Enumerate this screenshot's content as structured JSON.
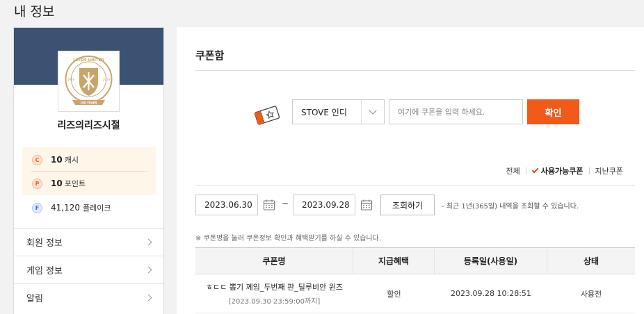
{
  "page": {
    "title": "내 정보"
  },
  "profile": {
    "badge_text": "LEEDS UNITED",
    "badge_year_left": "1919",
    "badge_year_right": "2019",
    "badge_banner": "100 YEARS",
    "nickname": "리즈의리즈시절",
    "wallet": {
      "cash": {
        "symbol": "C",
        "amount": "10",
        "unit": "캐시"
      },
      "point": {
        "symbol": "P",
        "amount": "10",
        "unit": "포인트"
      }
    },
    "flake": {
      "symbol": "F",
      "amount": "41,120",
      "unit": "플레이크"
    },
    "menu": [
      {
        "label": "회원 정보"
      },
      {
        "label": "게임 정보"
      },
      {
        "label": "알림"
      }
    ]
  },
  "coupon": {
    "title": "쿠폰함",
    "select_value": "STOVE 인디",
    "input_placeholder": "여기에 쿠폰을 입력 하세요.",
    "confirm_label": "확인",
    "filters": [
      {
        "label": "전체",
        "active": false
      },
      {
        "label": "사용가능쿠폰",
        "active": true
      },
      {
        "label": "지난쿠폰",
        "active": false
      }
    ],
    "date_start": "2023.06.30",
    "date_separator": "~",
    "date_end": "2023.09.28",
    "query_label": "조회하기",
    "query_note": "- 최근 1년(365일) 내역을 조회할 수 있습니다.",
    "hint": "※ 쿠폰명을 눌러 쿠폰정보 확인과 혜택받기를 하실 수 있습니다.",
    "table": {
      "headers": [
        "쿠폰명",
        "지급혜택",
        "등록일(사용일)",
        "상태"
      ],
      "rows": [
        {
          "name": "ㅎㄷㄷ 뽑기 께임_두번째 판_딜루비안 윈즈",
          "expiry": "[2023.09.30 23:59:00까지]",
          "benefit": "할인",
          "registered": "2023.09.28 10:28:51",
          "status": "사용전"
        }
      ]
    }
  },
  "colors": {
    "accent": "#f15a18",
    "banner": "#3b5272",
    "wallet_bg": "#fff6ea",
    "badge_gold": "#c9a46a"
  }
}
